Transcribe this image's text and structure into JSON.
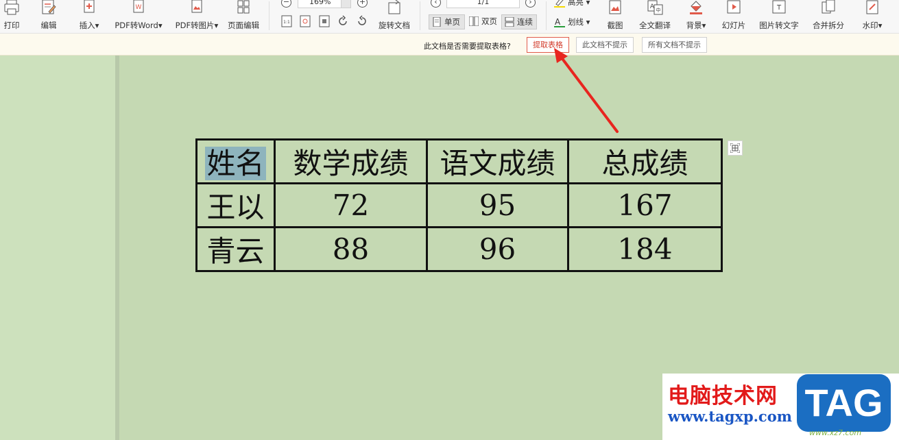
{
  "toolbar": {
    "print": "打印",
    "edit": "编辑",
    "insert": "插入▾",
    "pdf_to_word": "PDF转Word▾",
    "pdf_to_image": "PDF转图片▾",
    "page_edit": "页面编辑",
    "zoom": "169%",
    "rotate_doc": "旋转文档",
    "page_indicator": "1/1",
    "single_page": "单页",
    "double_page": "双页",
    "continuous": "连续",
    "highlight": "高亮 ▾",
    "strikeline": "划线 ▾",
    "screenshot": "截图",
    "full_translate": "全文翻译",
    "background": "背景▾",
    "slideshow": "幻灯片",
    "image_to_text": "图片转文字",
    "merge_split": "合并拆分",
    "watermark": "水印▾"
  },
  "notification": {
    "question": "此文档是否需要提取表格?",
    "extract_button": "提取表格",
    "dont_show_doc": "此文档不提示",
    "dont_show_all": "所有文档不提示"
  },
  "document": {
    "table": {
      "headers": [
        "姓名",
        "数学成绩",
        "语文成绩",
        "总成绩"
      ],
      "rows": [
        [
          "王以",
          "72",
          "95",
          "167"
        ],
        [
          "青云",
          "88",
          "96",
          "184"
        ]
      ]
    }
  },
  "watermark": {
    "title": "电脑技术网",
    "url": "www.tagxp.com",
    "tag": "TAG",
    "sub": "www.xz7.com"
  },
  "colors": {
    "page_background": "#c5d9b3",
    "accent_red": "#e15a4a",
    "arrow": "#e8251f"
  }
}
